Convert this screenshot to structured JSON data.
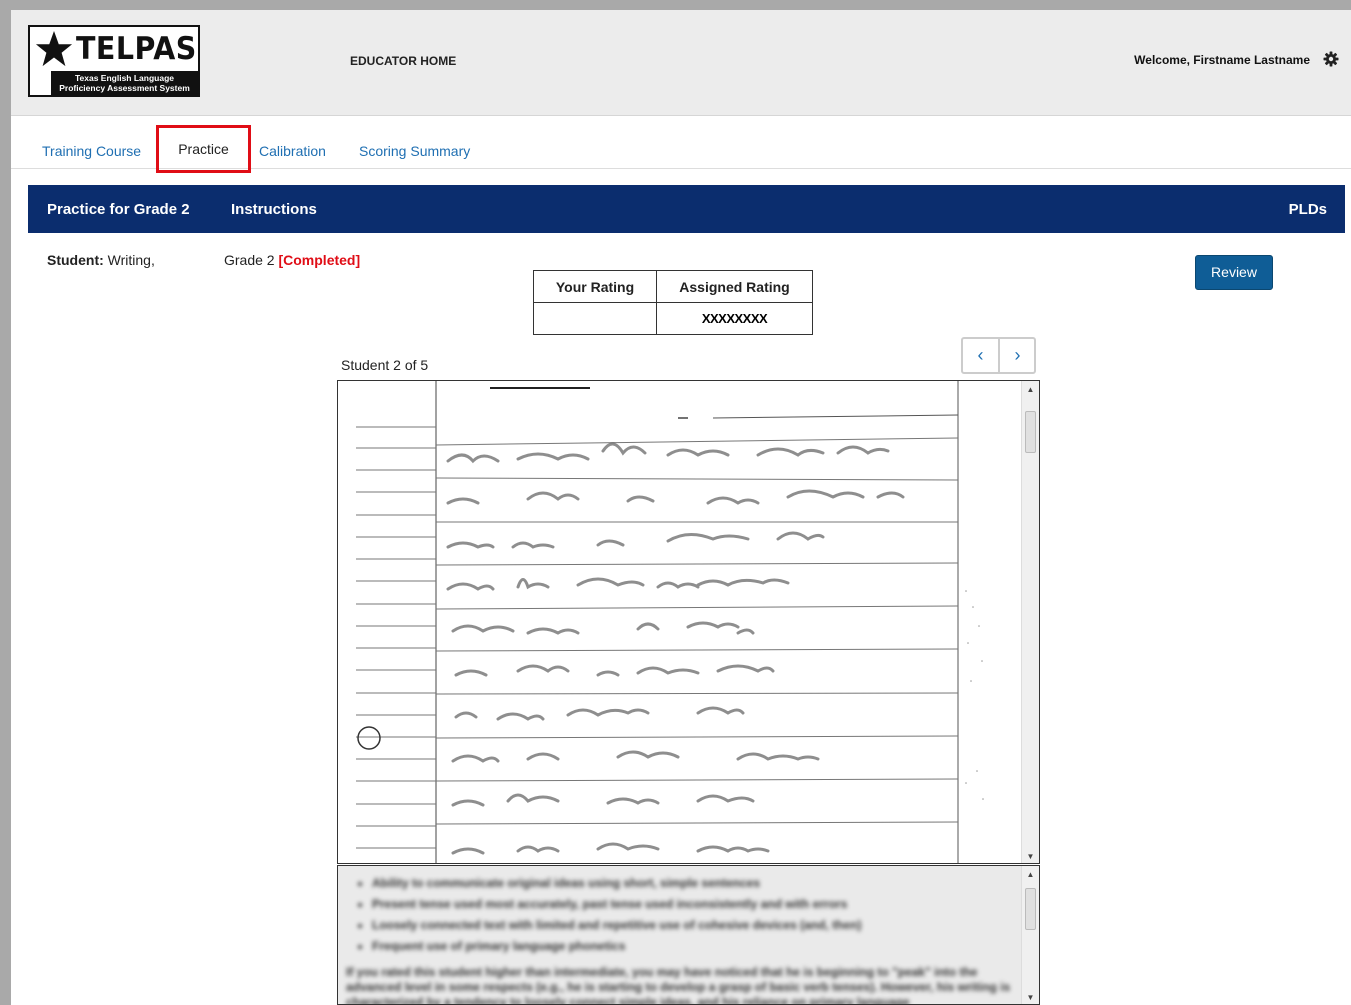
{
  "header": {
    "logo_word": "TELPAS",
    "logo_subtitle_line1": "Texas English Language",
    "logo_subtitle_line2": "Proficiency Assessment System",
    "nav_home": "EDUCATOR HOME",
    "welcome": "Welcome, Firstname Lastname",
    "settings_icon": "gear-icon"
  },
  "tabs": {
    "training": "Training Course",
    "practice": "Practice",
    "calibration": "Calibration",
    "scoring_summary": "Scoring Summary",
    "active": "Practice"
  },
  "banner": {
    "title": "Practice for Grade 2",
    "instructions": "Instructions",
    "plds": "PLDs"
  },
  "student": {
    "label": "Student:",
    "value": " Writing,",
    "grade": "Grade 2 ",
    "status": "[Completed]"
  },
  "review_button": "Review",
  "rating_table": {
    "your_rating_header": "Your Rating",
    "assigned_rating_header": "Assigned Rating",
    "your_rating_value": "",
    "assigned_rating_value": "XXXXXXXX"
  },
  "pager": {
    "prev_icon": "chevron-left-icon",
    "next_icon": "chevron-right-icon",
    "prev": "‹",
    "next": "›"
  },
  "student_count": "Student 2 of 5",
  "feedback": {
    "bullets": [
      "Ability to communicate original ideas using short, simple sentences",
      "Present tense used most accurately, past tense used inconsistently and with errors",
      "Loosely connected text with limited and repetitive use of cohesive devices (and, then)",
      "Frequent use of primary language phonetics"
    ],
    "paragraph": "If you rated this student higher than intermediate, you may have noticed that he is beginning to \"peak\" into the advanced level in some respects (e.g., he is starting to develop a grasp of basic verb tenses). However, his writing is characterized by a tendency to loosely connect simple ideas, and his reliance on primary language"
  },
  "colors": {
    "banner": "#0b2d6e",
    "link": "#1f6fb2",
    "completed": "#e00d16",
    "review_button": "#0f5d96",
    "active_tab_outline": "#e00d16"
  }
}
